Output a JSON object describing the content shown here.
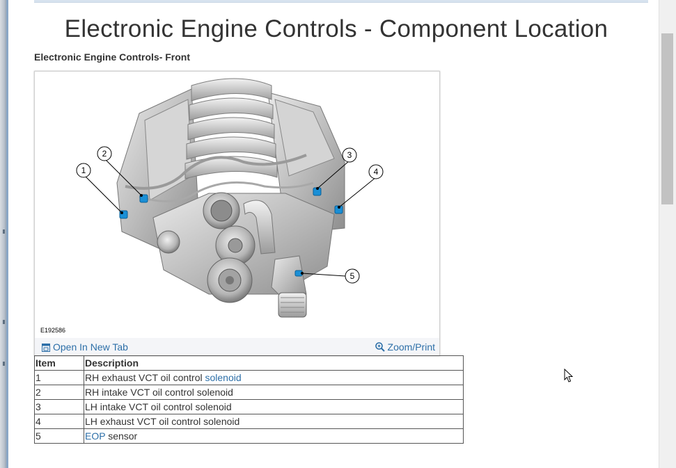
{
  "page": {
    "title": "Electronic Engine Controls - Component Location",
    "subtitle": "Electronic Engine Controls- Front"
  },
  "figure": {
    "id_label": "E192586",
    "callouts": [
      "1",
      "2",
      "3",
      "4",
      "5"
    ],
    "open_new_tab_label": "Open In New Tab",
    "zoom_print_label": "Zoom/Print",
    "icons": {
      "open": "open-new-tab-icon",
      "zoom": "zoom-icon"
    },
    "highlight_color": "#1a8fd6"
  },
  "table": {
    "headers": [
      "Item",
      "Description"
    ],
    "rows": [
      {
        "item": "1",
        "desc": "RH exhaust VCT oil control ",
        "link": "solenoid",
        "after": ""
      },
      {
        "item": "2",
        "desc": "RH intake VCT oil control solenoid",
        "link": "",
        "after": ""
      },
      {
        "item": "3",
        "desc": "LH intake VCT oil control solenoid",
        "link": "",
        "after": ""
      },
      {
        "item": "4",
        "desc": "LH exhaust VCT oil control solenoid",
        "link": "",
        "after": ""
      },
      {
        "item": "5",
        "desc": "",
        "link": "EOP",
        "after": " sensor"
      }
    ]
  },
  "colors": {
    "link": "#2d6fa8",
    "text": "#333333"
  }
}
